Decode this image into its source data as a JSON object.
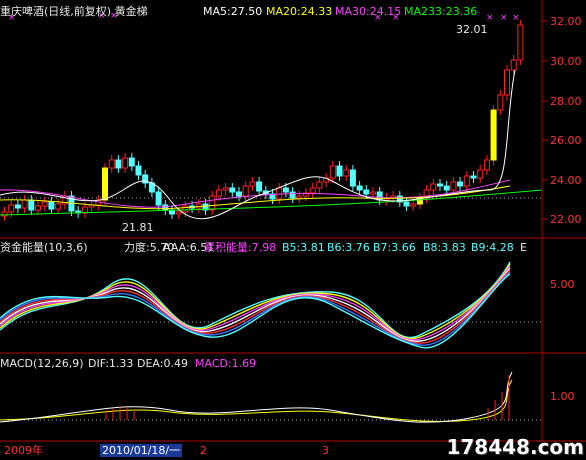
{
  "header": {
    "title": "重庆啤酒(日线,前复权) 黄金梯",
    "ma5": "MA5:27.50",
    "ma20": "MA20:24.33",
    "ma30": "MA30:24.15",
    "ma233": "MA233:23.36"
  },
  "price_axis": [
    "32.00",
    "30.00",
    "28.00",
    "26.00",
    "24.00",
    "22.00"
  ],
  "annotations": {
    "high": "32.01",
    "low": "21.81"
  },
  "indicator": {
    "name": "资金能量(10,3,6)",
    "lidu": "力度:5.70",
    "aaa": "AAA:6.51",
    "leiji": "累积能量:7.98",
    "b5": "B5:3.81",
    "b6": "B6:3.76",
    "b7": "B7:3.66",
    "b8": "B8:3.83",
    "b9": "B9:4.28",
    "more": "E",
    "axis": "5.00"
  },
  "macd": {
    "name": "MACD(12,26,9)",
    "dif": "DIF:1.33",
    "dea": "DEA:0.49",
    "macd": "MACD:1.69",
    "axis": "1.00"
  },
  "time_axis": {
    "year": "2009年",
    "cursor_date": "2010/01/18/一",
    "m2": "2",
    "m3": "3"
  },
  "watermark": "178448.com",
  "colors": {
    "up": "#ff2020",
    "down": "#54ffff",
    "panel_border": "#b00000",
    "ma5": "#ffffff",
    "ma20": "#ffff00",
    "ma30": "#ff40ff",
    "ma233": "#00ff00"
  }
}
